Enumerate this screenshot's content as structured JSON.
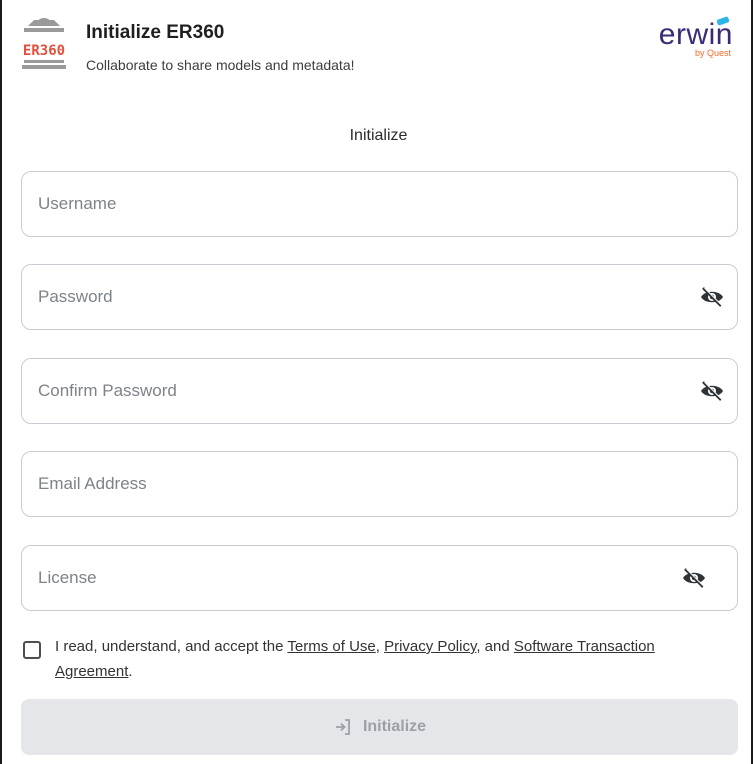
{
  "header": {
    "logo_text": "ER360",
    "title": "Initialize ER360",
    "subtitle": "Collaborate to share models and metadata!",
    "brand": "erwin",
    "brand_sub": "by Quest"
  },
  "form": {
    "title": "Initialize",
    "username_placeholder": "Username",
    "password_placeholder": "Password",
    "confirm_password_placeholder": "Confirm Password",
    "email_placeholder": "Email Address",
    "license_placeholder": "License",
    "agree_prefix": "I read, understand, and accept the ",
    "terms_link": "Terms of Use",
    "sep1": ", ",
    "privacy_link": "Privacy Policy",
    "sep2": ", and ",
    "sta_link": "Software Transaction Agreement",
    "agree_suffix": ".",
    "submit_label": "Initialize"
  },
  "icons": {
    "visibility_toggle": "eye-off-icon",
    "submit": "login-arrow-icon"
  },
  "colors": {
    "brand_purple": "#3a2a78",
    "brand_orange": "#f26b2a",
    "logo_red": "#e0503c",
    "disabled_button_bg": "#e4e6e9"
  }
}
